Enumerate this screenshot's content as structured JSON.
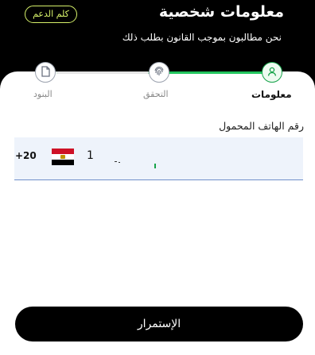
{
  "header": {
    "support_label": "كلم الدعم",
    "title": "معلومات شخصية",
    "subtitle": "نحن مطالبون بموجب القانون بطلب ذلك"
  },
  "stepper": {
    "steps": [
      {
        "label": "البنود",
        "icon": "document-icon",
        "state": "pending"
      },
      {
        "label": "التحقق",
        "icon": "fingerprint-icon",
        "state": "pending"
      },
      {
        "label": "معلومات",
        "icon": "user-icon",
        "state": "active"
      }
    ],
    "colors": {
      "active": "#16a34a",
      "pending": "#9ca3af"
    }
  },
  "form": {
    "phone_label": "رقم الهاتف المحمول",
    "dial_code": "+20",
    "country_flag": "egypt-flag",
    "phone_value": "1"
  },
  "footer": {
    "continue_label": "الإستمرار"
  },
  "colors": {
    "accent": "#d7f26a",
    "progress": "#22c55e",
    "field_bg": "#eef3fb",
    "field_border": "#6f8fc9"
  }
}
